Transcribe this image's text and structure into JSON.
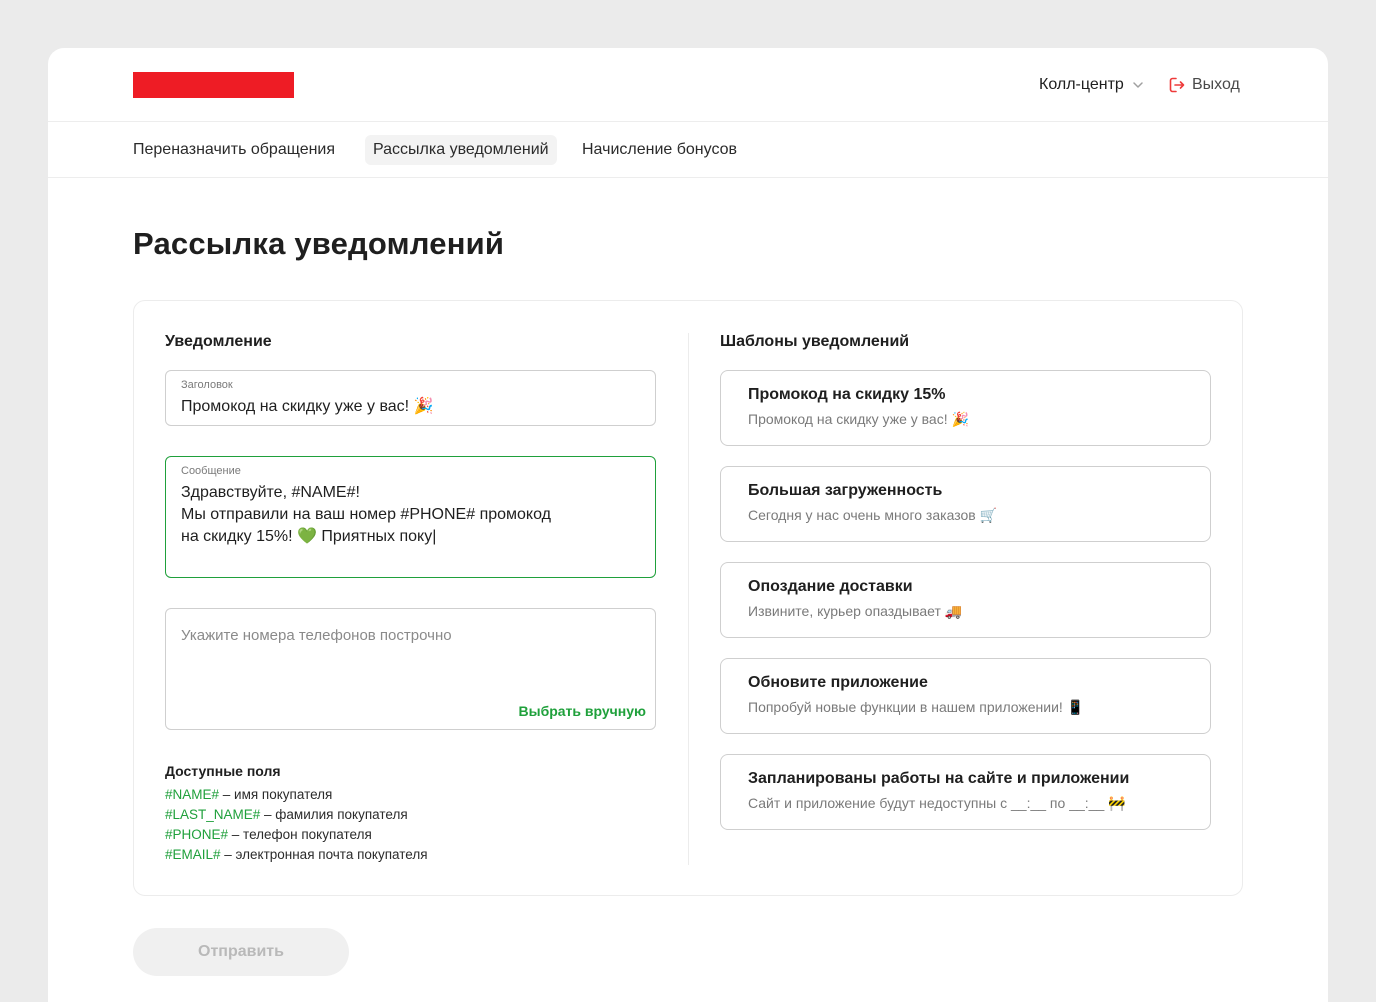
{
  "header": {
    "role": "Колл-центр",
    "logout_label": "Выход",
    "brand_color": "#ee1c25"
  },
  "nav": {
    "items": [
      {
        "label": "Переназначить обращения"
      },
      {
        "label": "Рассылка уведомлений",
        "active": true
      },
      {
        "label": "Начисление бонусов"
      }
    ]
  },
  "page": {
    "title": "Рассылка уведомлений"
  },
  "notification": {
    "section_title": "Уведомление",
    "title_field": {
      "label": "Заголовок",
      "value": "Промокод на скидку уже у вас! 🎉"
    },
    "message_field": {
      "label": "Сообщение",
      "value": "Здравствуйте, #NAME#!\nМы отправили на ваш номер #PHONE# промокод\nна скидку 15%! 💚 Приятных поку|"
    },
    "phones_field": {
      "placeholder": "Укажите номера телефонов построчно",
      "pick_manually": "Выбрать вручную"
    },
    "available_fields": {
      "title": "Доступные поля",
      "items": [
        {
          "tag": "#NAME#",
          "desc": " – имя покупателя"
        },
        {
          "tag": "#LAST_NAME#",
          "desc": " – фамилия покупателя"
        },
        {
          "tag": "#PHONE#",
          "desc": " – телефон покупателя"
        },
        {
          "tag": "#EMAIL#",
          "desc": " – электронная почта покупателя"
        }
      ]
    }
  },
  "templates": {
    "section_title": "Шаблоны уведомлений",
    "items": [
      {
        "title": "Промокод на скидку 15%",
        "text": "Промокод на скидку уже у вас! 🎉"
      },
      {
        "title": "Большая загруженность",
        "text": "Сегодня у нас очень много заказов 🛒"
      },
      {
        "title": "Опоздание доставки",
        "text": "Извините, курьер опаздывает 🚚"
      },
      {
        "title": "Обновите приложение",
        "text": "Попробуй новые функции в нашем приложении! 📱"
      },
      {
        "title": "Запланированы работы на сайте и приложении",
        "text": "Сайт и приложение будут недоступны с __:__ по __:__ 🚧"
      }
    ]
  },
  "actions": {
    "send_label": "Отправить",
    "accent_color": "#1fa03b"
  }
}
